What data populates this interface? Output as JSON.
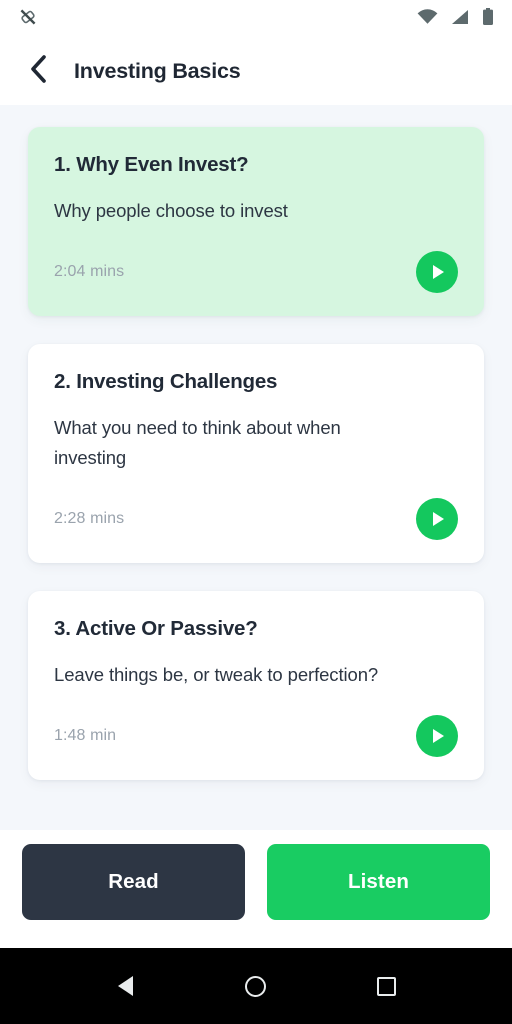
{
  "status_bar": {
    "left_icons": [
      {
        "name": "no-sim-icon"
      }
    ],
    "right_icons": [
      {
        "name": "wifi-icon"
      },
      {
        "name": "cellular-signal-icon"
      },
      {
        "name": "battery-icon"
      }
    ]
  },
  "app_bar": {
    "back_icon": "chevron-left-icon",
    "title": "Investing Basics"
  },
  "lessons": [
    {
      "title": "1. Why Even Invest?",
      "description": "Why people choose to invest",
      "duration": "2:04 mins",
      "active": true,
      "play_icon": "play-icon"
    },
    {
      "title": "2. Investing Challenges",
      "description": "What you need to think about when investing",
      "duration": "2:28 mins",
      "active": false,
      "play_icon": "play-icon"
    },
    {
      "title": "3. Active Or Passive?",
      "description": "Leave things be, or tweak to perfection?",
      "duration": "1:48 min",
      "active": false,
      "play_icon": "play-icon"
    }
  ],
  "action_bar": {
    "read_label": "Read",
    "listen_label": "Listen"
  },
  "nav_bar": {
    "back_icon": "android-back-icon",
    "home_icon": "android-home-icon",
    "recents_icon": "android-recents-icon"
  },
  "colors": {
    "accent_green": "#19cc62",
    "card_active_bg": "#d6f6e0",
    "dark_button": "#2d3644",
    "page_bg": "#f4f7fb",
    "title_text": "#212a37",
    "muted_text": "#9aa3ad"
  }
}
